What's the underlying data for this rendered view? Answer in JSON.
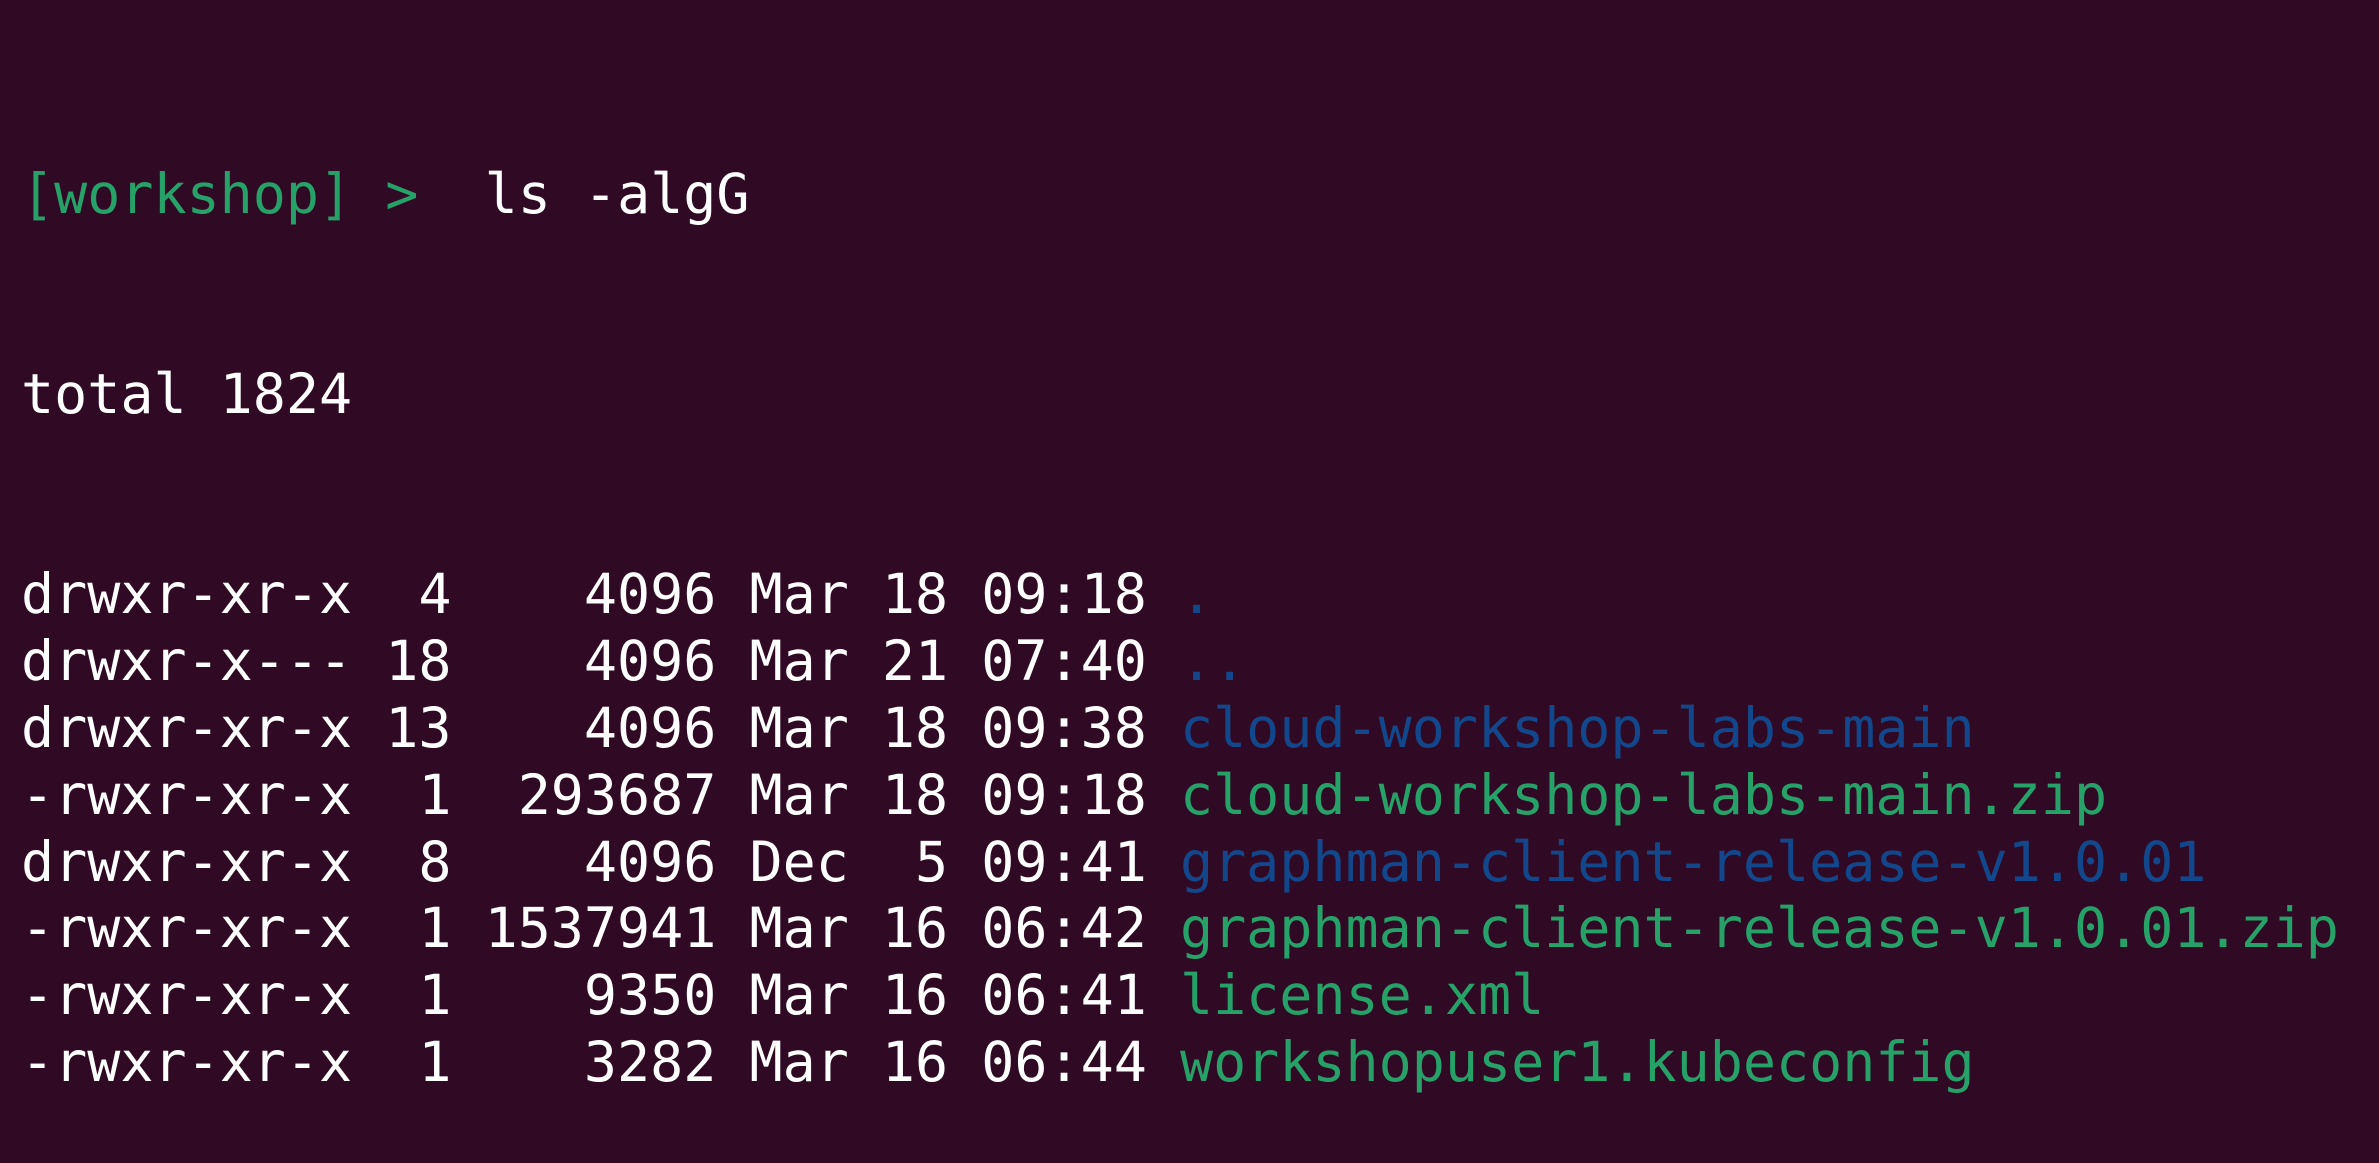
{
  "colors": {
    "background": "#300a24",
    "text": "#ffffff",
    "prompt": "#26a269",
    "directory": "#12488b",
    "executable": "#26a269"
  },
  "prompt": {
    "label": "[workshop]",
    "symbol": ">",
    "command": "ls -algG"
  },
  "total": "total 1824",
  "entries": [
    {
      "meta": "drwxr-xr-x  4    4096 Mar 18 09:18 ",
      "name": ".",
      "type": "directory"
    },
    {
      "meta": "drwxr-x--- 18    4096 Mar 21 07:40 ",
      "name": "..",
      "type": "directory"
    },
    {
      "meta": "drwxr-xr-x 13    4096 Mar 18 09:38 ",
      "name": "cloud-workshop-labs-main",
      "type": "directory"
    },
    {
      "meta": "-rwxr-xr-x  1  293687 Mar 18 09:18 ",
      "name": "cloud-workshop-labs-main.zip",
      "type": "executable"
    },
    {
      "meta": "drwxr-xr-x  8    4096 Dec  5 09:41 ",
      "name": "graphman-client-release-v1.0.01",
      "type": "directory"
    },
    {
      "meta": "-rwxr-xr-x  1 1537941 Mar 16 06:42 ",
      "name": "graphman-client-release-v1.0.01.zip",
      "type": "executable"
    },
    {
      "meta": "-rwxr-xr-x  1    9350 Mar 16 06:41 ",
      "name": "license.xml",
      "type": "executable"
    },
    {
      "meta": "-rwxr-xr-x  1    3282 Mar 16 06:44 ",
      "name": "workshopuser1.kubeconfig",
      "type": "executable"
    }
  ]
}
